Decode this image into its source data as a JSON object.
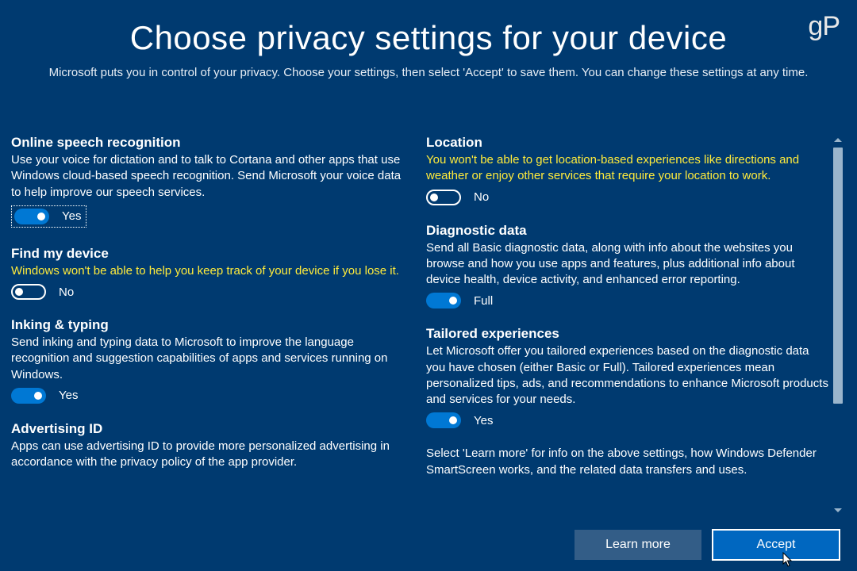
{
  "watermark": "gP",
  "header": {
    "title": "Choose privacy settings for your device",
    "subtitle": "Microsoft puts you in control of your privacy. Choose your settings, then select 'Accept' to save them. You can change these settings at any time."
  },
  "left": {
    "speech": {
      "title": "Online speech recognition",
      "desc": "Use your voice for dictation and to talk to Cortana and other apps that use Windows cloud-based speech recognition. Send Microsoft your voice data to help improve our speech services.",
      "state_label": "Yes",
      "on": true,
      "focused": true
    },
    "find": {
      "title": "Find my device",
      "desc": "Windows won't be able to help you keep track of your device if you lose it.",
      "state_label": "No",
      "on": false,
      "warn": true
    },
    "inking": {
      "title": "Inking & typing",
      "desc": "Send inking and typing data to Microsoft to improve the language recognition and suggestion capabilities of apps and services running on Windows.",
      "state_label": "Yes",
      "on": true
    },
    "adid": {
      "title": "Advertising ID",
      "desc": "Apps can use advertising ID to provide more personalized advertising in accordance with the privacy policy of the app provider."
    }
  },
  "right": {
    "location": {
      "title": "Location",
      "desc": "You won't be able to get location-based experiences like directions and weather or enjoy other services that require your location to work.",
      "state_label": "No",
      "on": false,
      "warn": true
    },
    "diag": {
      "title": "Diagnostic data",
      "desc": "Send all Basic diagnostic data, along with info about the websites you browse and how you use apps and features, plus additional info about device health, device activity, and enhanced error reporting.",
      "state_label": "Full",
      "on": true
    },
    "tailored": {
      "title": "Tailored experiences",
      "desc": "Let Microsoft offer you tailored experiences based on the diagnostic data you have chosen (either Basic or Full). Tailored experiences mean personalized tips, ads, and recommendations to enhance Microsoft products and services for your needs.",
      "state_label": "Yes",
      "on": true
    },
    "info": "Select 'Learn more' for info on the above settings, how Windows Defender SmartScreen works, and the related data transfers and uses."
  },
  "footer": {
    "learn_more": "Learn more",
    "accept": "Accept"
  }
}
